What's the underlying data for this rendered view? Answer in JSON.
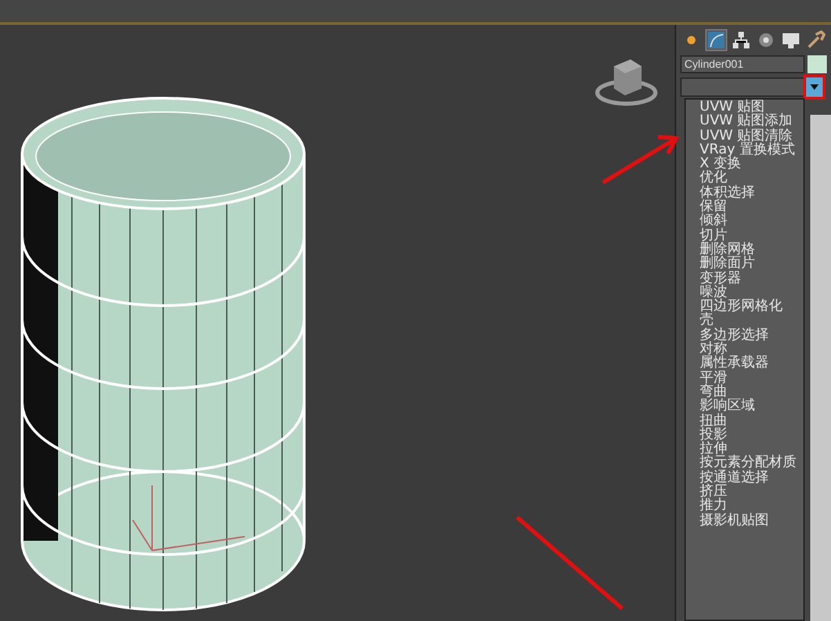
{
  "command_panel": {
    "tabs": [
      {
        "kind": "create",
        "selected": false
      },
      {
        "kind": "modify",
        "selected": true
      },
      {
        "kind": "hierarchy",
        "selected": false
      },
      {
        "kind": "motion",
        "selected": false
      },
      {
        "kind": "display",
        "selected": false
      },
      {
        "kind": "utilities",
        "selected": false
      }
    ],
    "object_name": "Cylinder001",
    "modifier_list": {
      "items": [
        "UVW 贴图",
        "UVW 贴图添加",
        "UVW 贴图清除",
        "VRay 置换模式",
        "X 变换",
        "优化",
        "体积选择",
        "保留",
        "倾斜",
        "切片",
        "删除网格",
        "删除面片",
        "变形器",
        "噪波",
        "四边形网格化",
        "壳",
        "多边形选择",
        "对称",
        "属性承载器",
        "平滑",
        "弯曲",
        "影响区域",
        "扭曲",
        "投影",
        "拉伸",
        "按元素分配材质",
        "按通道选择",
        "挤压",
        "推力",
        "摄影机贴图"
      ]
    }
  }
}
